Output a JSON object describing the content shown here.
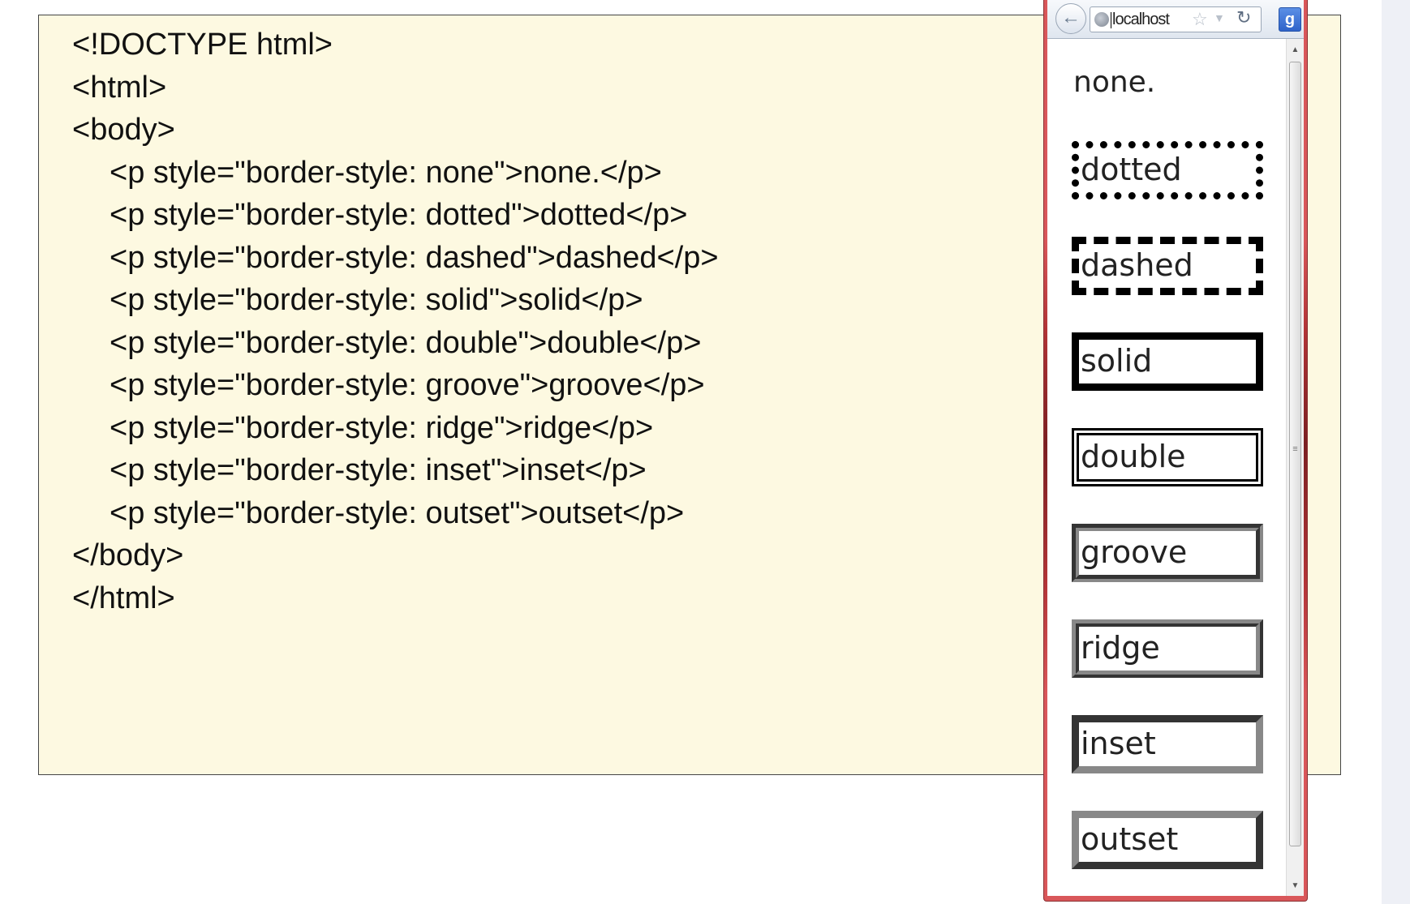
{
  "code": {
    "lines": [
      "<!DOCTYPE html>",
      "<html>",
      "<body>",
      "<p style=\"border-style: none\">none.</p>",
      "<p style=\"border-style: dotted\">dotted</p>",
      "<p style=\"border-style: dashed\">dashed</p>",
      "<p style=\"border-style: solid\">solid</p>",
      "<p style=\"border-style: double\">double</p>",
      "<p style=\"border-style: groove\">groove</p>",
      "<p style=\"border-style: ridge\">ridge</p>",
      "<p style=\"border-style: inset\">inset</p>",
      "<p style=\"border-style: outset\">outset</p>",
      "</body>",
      "</html>"
    ]
  },
  "browser": {
    "url": "localhost",
    "search_button_label": "g",
    "icons": [
      "back-arrow-icon",
      "globe-icon",
      "star-icon",
      "dropdown-icon",
      "reload-icon",
      "google-search-icon"
    ],
    "accent_color": "#d9575a"
  },
  "demo": {
    "items": [
      "none.",
      "dotted",
      "dashed",
      "solid",
      "double",
      "groove",
      "ridge",
      "inset",
      "outset"
    ]
  }
}
